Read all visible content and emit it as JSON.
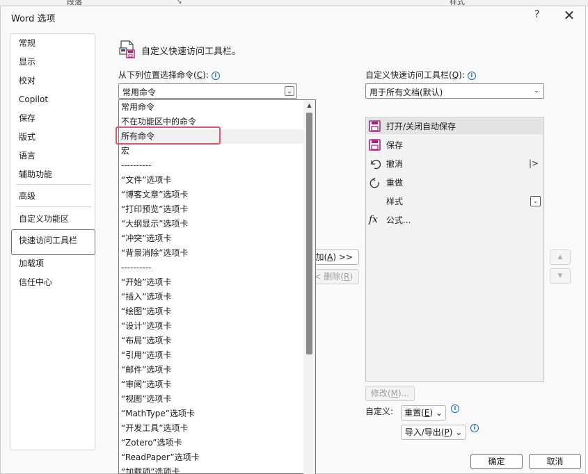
{
  "background": {
    "left_text": "段落",
    "right_text": "样式"
  },
  "window": {
    "title": "Word 选项",
    "help_label": "?",
    "close_label": "✕"
  },
  "nav": {
    "items": [
      "常规",
      "显示",
      "校对",
      "Copilot",
      "保存",
      "版式",
      "语言",
      "辅助功能",
      "高级",
      "自定义功能区",
      "快速访问工具栏",
      "加载项",
      "信任中心"
    ],
    "selected": "快速访问工具栏"
  },
  "main": {
    "header_title": "自定义快速访问工具栏。",
    "choose_label": "从下列位置选择命令",
    "choose_hotkey": "C",
    "choose_value": "常用命令",
    "customize_label": "自定义快速访问工具栏",
    "customize_hotkey": "Q",
    "customize_value": "用于所有文档(默认)"
  },
  "dropdown": {
    "items": [
      "常用命令",
      "不在功能区中的命令",
      "所有命令",
      "宏",
      "----------",
      "“文件”选项卡",
      "“博客文章”选项卡",
      "“打印预览”选项卡",
      "“大纲显示”选项卡",
      "“冲突”选项卡",
      "“背景消除”选项卡",
      "----------",
      "“开始”选项卡",
      "“插入”选项卡",
      "“绘图”选项卡",
      "“设计”选项卡",
      "“布局”选项卡",
      "“引用”选项卡",
      "“邮件”选项卡",
      "“审阅”选项卡",
      "“视图”选项卡",
      "“MathType”选项卡",
      "“开发工具”选项卡",
      "“Zotero”选项卡",
      "“ReadPaper”选项卡",
      "“加载项”选项卡"
    ],
    "hovered": "所有命令",
    "highlighted": "所有命令"
  },
  "buttons": {
    "add": "添加(A) >>",
    "add_prefix": "添加(",
    "add_key": "A",
    "add_suffix": ") >>",
    "remove_prefix": "< 删除(",
    "remove_key": "R",
    "remove_suffix": ")",
    "modify_prefix": "修改(",
    "modify_key": "M",
    "modify_suffix": ")...",
    "customize_label": "自定义:",
    "reset_prefix": "重置(",
    "reset_key": "E",
    "reset_suffix": ")",
    "import_prefix": "导入/导出(",
    "import_key": "P",
    "import_suffix": ")",
    "ok": "确定",
    "cancel": "取消",
    "move_up": "▲",
    "move_down": "▼"
  },
  "toolbar_commands": [
    {
      "label": "打开/关闭自动保存",
      "icon": "save-autosave-icon"
    },
    {
      "label": "保存",
      "icon": "save-icon"
    },
    {
      "label": "撤消",
      "icon": "undo-icon",
      "extra": "|>"
    },
    {
      "label": "重做",
      "icon": "redo-icon"
    },
    {
      "label": "样式",
      "icon": "style-gallery-icon",
      "extra": "dropdown"
    },
    {
      "label": "公式...",
      "icon": "formula-icon"
    }
  ],
  "colors": {
    "accent_purple": "#a7227e",
    "highlight_red": "#e0556c",
    "info_blue": "#1467c4"
  }
}
